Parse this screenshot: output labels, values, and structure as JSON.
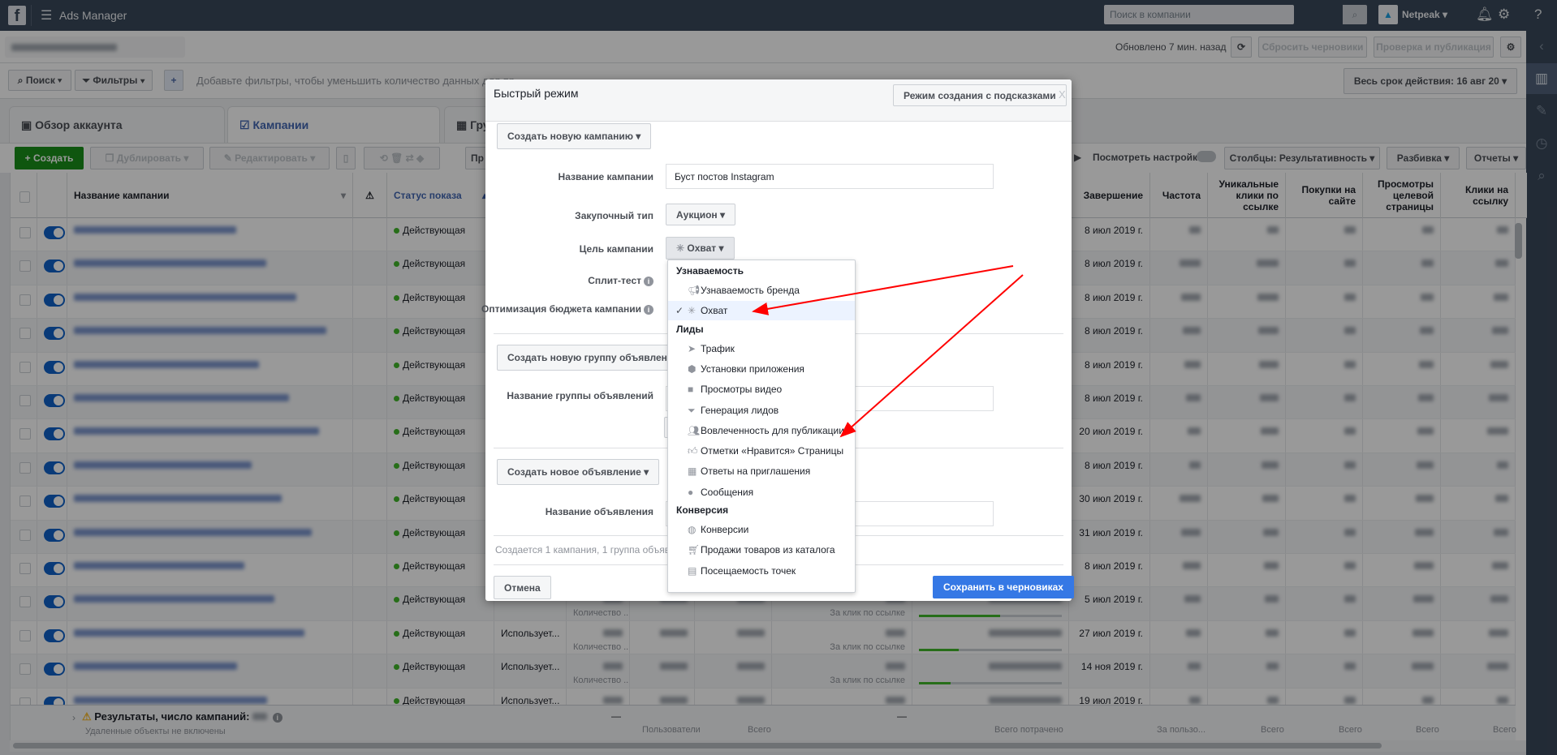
{
  "topbar": {
    "app_title": "Ads Manager",
    "search_placeholder": "Поиск в компании",
    "account_name": "Netpeak",
    "logo": "f"
  },
  "account_row": {
    "updated": "Обновлено 7 мин. назад",
    "reset_drafts": "Сбросить черновики",
    "review_publish": "Проверка и публикация"
  },
  "filters": {
    "search": "Поиск",
    "filters": "Фильтры",
    "add": "+",
    "hint": "Добавьте фильтры, чтобы уменьшить количество данных для пр",
    "date_range": "Весь срок действия: 16 авг 20"
  },
  "tabs": [
    {
      "label": "Обзор аккаунта"
    },
    {
      "label": "Кампании"
    },
    {
      "label": "Гру"
    }
  ],
  "toolbar": {
    "create": "Создать",
    "duplicate": "Дублировать",
    "edit": "Редактировать",
    "hidden_btn": "Пр",
    "view_settings": "Посмотреть настройки",
    "columns": "Столбцы: Результативность",
    "breakdown": "Разбивка",
    "reports": "Отчеты"
  },
  "table": {
    "headers": {
      "name": "Название кампании",
      "status": "Статус показа",
      "end": "Завершение",
      "frequency": "Частота",
      "unique_clicks": "Уникальные клики по ссылке",
      "purchases": "Покупки на сайте",
      "landing_views": "Просмотры целевой страницы",
      "link_clicks": "Клики на ссылку"
    },
    "rows": [
      {
        "status": "Действующая",
        "end": "8 июл 2019 г."
      },
      {
        "status": "Действующая",
        "end": "8 июл 2019 г."
      },
      {
        "status": "Действующая",
        "end": "8 июл 2019 г."
      },
      {
        "status": "Действующая",
        "end": "8 июл 2019 г."
      },
      {
        "status": "Действующая",
        "end": "8 июл 2019 г."
      },
      {
        "status": "Действующая",
        "end": "8 июл 2019 г."
      },
      {
        "status": "Действующая",
        "end": "20 июл 2019 г."
      },
      {
        "status": "Действующая",
        "end": "8 июл 2019 г."
      },
      {
        "status": "Действующая",
        "end": "30 июл 2019 г."
      },
      {
        "status": "Действующая",
        "end": "31 июл 2019 г."
      },
      {
        "status": "Действующая",
        "end": "8 июл 2019 г."
      },
      {
        "status": "Действующая",
        "end": "5 июл 2019 г.",
        "budget_sub": "Количество ...",
        "cost_sub": "За клик по ссылке",
        "progress": 57
      },
      {
        "status": "Действующая",
        "end": "27 июл 2019 г.",
        "bid": "Использует...",
        "budget_sub": "Количество ...",
        "cost_sub": "За клик по ссылке",
        "progress": 28
      },
      {
        "status": "Действующая",
        "end": "14 ноя 2019 г.",
        "bid": "Использует...",
        "budget_sub": "Количество ...",
        "cost_sub": "За клик по ссылке",
        "progress": 22
      },
      {
        "status": "Действующая",
        "end": "19 июл 2019 г.",
        "bid": "Использует..."
      }
    ],
    "footer": {
      "results": "Результаты, число кампаний:",
      "deleted_note": "Удаленные объекты не включены",
      "dash": "—",
      "users": "Пользователи",
      "total": "Всего",
      "total_spent": "Всего потрачено",
      "per_user": "За пользо..."
    }
  },
  "modal": {
    "title": "Быстрый режим",
    "guided_mode": "Режим создания с подсказками",
    "close": "X",
    "create_campaign": "Создать новую кампанию",
    "campaign_name_label": "Название кампании",
    "campaign_name_value": "Буст постов Instagram",
    "buying_type_label": "Закупочный тип",
    "buying_type_value": "Аукцион",
    "objective_label": "Цель кампании",
    "objective_value": "Охват",
    "split_test_label": "Сплит-тест",
    "cbo_label": "Оптимизация бюджета кампании",
    "create_adset": "Создать новую группу объявлений",
    "adset_name_label": "Название группы объявлений",
    "create_ad": "Создать новое объявление",
    "ad_name_label": "Название объявления",
    "summary": "Создается 1 кампания, 1 группа объявлен",
    "cancel": "Отмена",
    "save": "Сохранить в черновиках",
    "save_color": "#3578e5"
  },
  "objective_menu": {
    "groups": [
      {
        "title": "Узнаваемость",
        "items": [
          {
            "label": "Узнаваемость бренда",
            "icon": "megaphone-icon"
          },
          {
            "label": "Охват",
            "icon": "reach-icon",
            "selected": true
          }
        ]
      },
      {
        "title": "Лиды",
        "items": [
          {
            "label": "Трафик",
            "icon": "cursor-icon"
          },
          {
            "label": "Установки приложения",
            "icon": "box-icon"
          },
          {
            "label": "Просмотры видео",
            "icon": "video-icon"
          },
          {
            "label": "Генерация лидов",
            "icon": "funnel-icon"
          },
          {
            "label": "Вовлеченность для публикации",
            "icon": "people-icon"
          },
          {
            "label": "Отметки «Нравится» Страницы",
            "icon": "thumbs-up-icon"
          },
          {
            "label": "Ответы на приглашения",
            "icon": "calendar-icon"
          },
          {
            "label": "Сообщения",
            "icon": "chat-icon"
          }
        ]
      },
      {
        "title": "Конверсия",
        "items": [
          {
            "label": "Конверсии",
            "icon": "globe-icon"
          },
          {
            "label": "Продажи товаров из каталога",
            "icon": "cart-icon"
          },
          {
            "label": "Посещаемость точек",
            "icon": "store-icon"
          }
        ]
      }
    ]
  },
  "annotation_color": "#ff0000"
}
